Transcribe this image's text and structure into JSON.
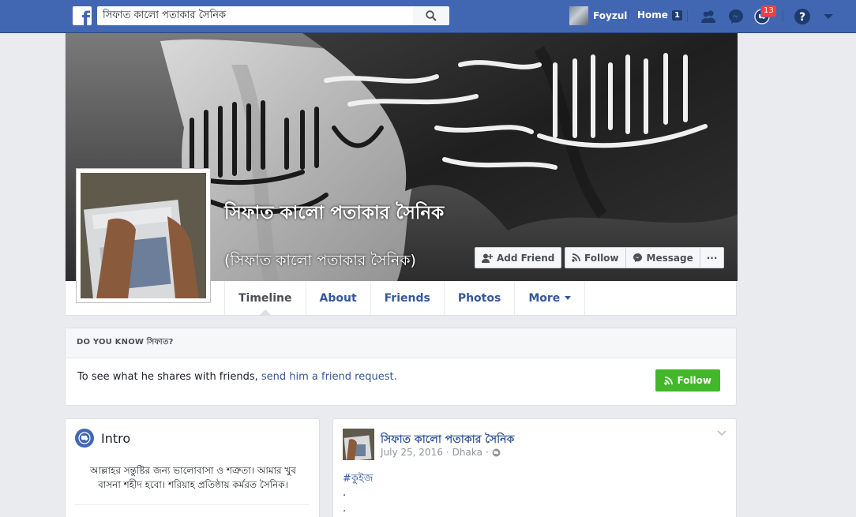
{
  "topbar": {
    "search_value": "সিফাত কালো পতাকার সৈনিক",
    "logo_letter": "f",
    "user_name": "Foyzul",
    "home_label": "Home",
    "home_count": "1",
    "notifications_count": "13",
    "icons": [
      "facebook-logo-icon",
      "search-icon",
      "friend-requests-icon",
      "messenger-icon",
      "notifications-globe-icon",
      "help-icon",
      "caret-down-icon"
    ]
  },
  "profile": {
    "name": "সিফাত কালো পতাকার সৈনিক",
    "alternate_name": "(সিফাত কালো পতাকার সৈনিক)",
    "buttons": {
      "add_friend": "Add Friend",
      "follow": "Follow",
      "message": "Message",
      "more": "···"
    },
    "tabs": [
      {
        "label": "Timeline"
      },
      {
        "label": "About"
      },
      {
        "label": "Friends"
      },
      {
        "label": "Photos"
      },
      {
        "label": "More"
      }
    ]
  },
  "do_you_know": {
    "header": "DO YOU KNOW সিফাত?",
    "text": "To see what he shares with friends, ",
    "link": "send him a friend request.",
    "follow_label": "Follow"
  },
  "intro": {
    "title": "Intro",
    "bio": "আল্লাহর সন্তুষ্টির জন্য ভালোবাসা ও শত্রুতা। আমার খুব বাসনা শহীদ হবো। শরিয়াহ প্রতিষ্ঠায় কর্মরত সৈনিক।"
  },
  "post": {
    "author": "সিফাত কালো পতাকার সৈনিক",
    "date": "July 25, 2016",
    "separator": "·",
    "location": "Dhaka",
    "hashtag": "#কুইজ",
    "lines": [
      ".",
      "."
    ]
  },
  "colors": {
    "brand_blue": "#4267b2",
    "link_blue": "#365899",
    "follow_green": "#42b72a",
    "badge_red": "#fa3e3e",
    "page_bg": "#e9ebee"
  }
}
